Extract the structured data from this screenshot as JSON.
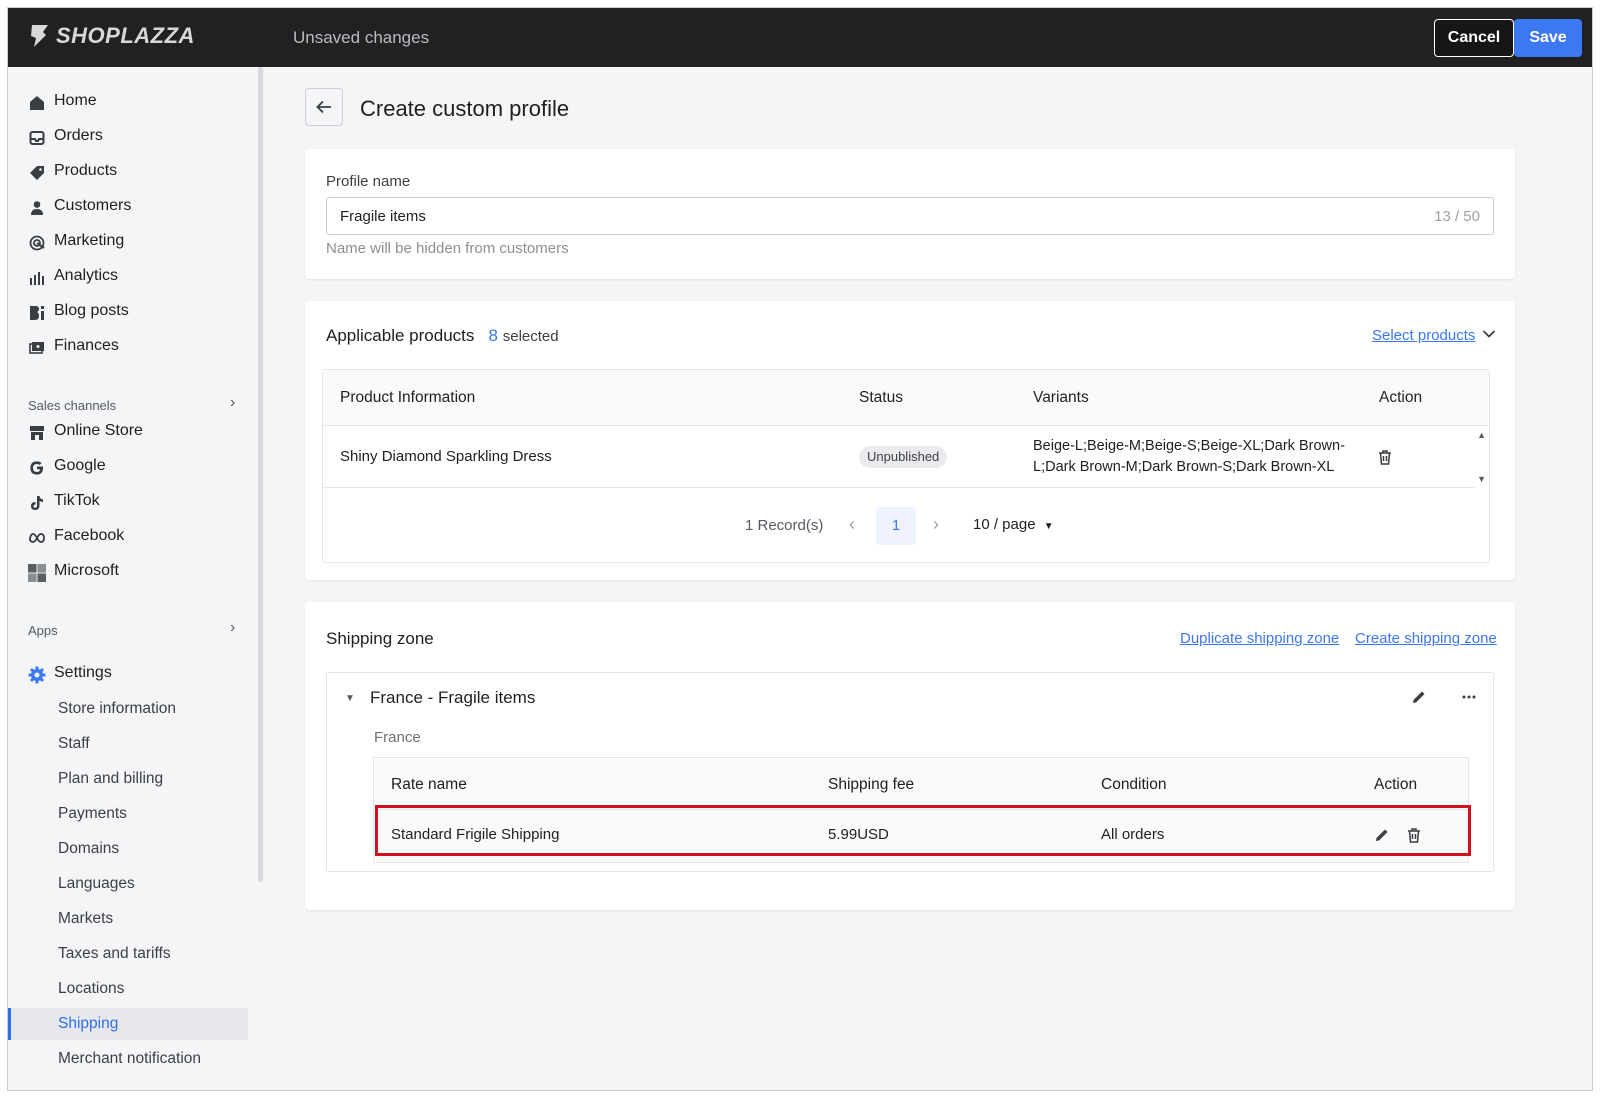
{
  "topbar": {
    "brand": "SHOPLAZZA",
    "status": "Unsaved changes",
    "cancel_label": "Cancel",
    "save_label": "Save"
  },
  "sidebar": {
    "main_items": [
      {
        "label": "Home",
        "icon": "home-icon"
      },
      {
        "label": "Orders",
        "icon": "inbox-icon"
      },
      {
        "label": "Products",
        "icon": "tag-icon"
      },
      {
        "label": "Customers",
        "icon": "person-icon"
      },
      {
        "label": "Marketing",
        "icon": "target-icon"
      },
      {
        "label": "Analytics",
        "icon": "bar-chart-icon"
      },
      {
        "label": "Blog posts",
        "icon": "blog-icon"
      },
      {
        "label": "Finances",
        "icon": "finance-icon"
      }
    ],
    "sales_channels_label": "Sales channels",
    "channels": [
      {
        "label": "Online Store",
        "icon": "store-icon"
      },
      {
        "label": "Google",
        "icon": "google-icon"
      },
      {
        "label": "TikTok",
        "icon": "tiktok-icon"
      },
      {
        "label": "Facebook",
        "icon": "meta-icon"
      },
      {
        "label": "Microsoft",
        "icon": "microsoft-icon"
      }
    ],
    "apps_label": "Apps",
    "settings_label": "Settings",
    "settings_items": [
      "Store information",
      "Staff",
      "Plan and billing",
      "Payments",
      "Domains",
      "Languages",
      "Markets",
      "Taxes and tariffs",
      "Locations",
      "Shipping",
      "Merchant notification"
    ],
    "active_settings_item": "Shipping"
  },
  "page": {
    "title": "Create custom profile"
  },
  "profile": {
    "label": "Profile name",
    "value": "Fragile items",
    "counter": "13 / 50",
    "help": "Name will be hidden from customers"
  },
  "products": {
    "title": "Applicable products",
    "selected_count": "8",
    "selected_word": "selected",
    "select_link": "Select products",
    "columns": [
      "Product Information",
      "Status",
      "Variants",
      "Action"
    ],
    "rows": [
      {
        "name": "Shiny Diamond Sparkling Dress",
        "status": "Unpublished",
        "variants": "Beige-L;Beige-M;Beige-S;Beige-XL;Dark Brown-L;Dark Brown-M;Dark Brown-S;Dark Brown-XL"
      }
    ],
    "records": "1 Record(s)",
    "current_page": "1",
    "page_size": "10 / page"
  },
  "shipping": {
    "title": "Shipping zone",
    "duplicate_link": "Duplicate shipping zone",
    "create_link": "Create shipping zone",
    "zone_name": "France - Fragile items",
    "zone_country": "France",
    "columns": [
      "Rate name",
      "Shipping fee",
      "Condition",
      "Action"
    ],
    "rates": [
      {
        "name": "Standard Frigile Shipping",
        "fee": "5.99USD",
        "condition": "All orders"
      }
    ]
  },
  "colors": {
    "accent": "#3b78f2",
    "topbar": "#202123",
    "highlight": "#d0101f"
  }
}
